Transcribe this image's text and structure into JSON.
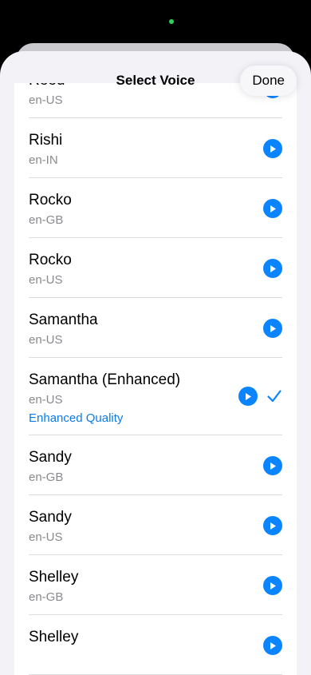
{
  "header": {
    "title": "Select Voice",
    "done_label": "Done"
  },
  "voices": [
    {
      "name": "Reed",
      "locale": "en-US"
    },
    {
      "name": "Rishi",
      "locale": "en-IN"
    },
    {
      "name": "Rocko",
      "locale": "en-GB"
    },
    {
      "name": "Rocko",
      "locale": "en-US"
    },
    {
      "name": "Samantha",
      "locale": "en-US"
    },
    {
      "name": "Samantha (Enhanced)",
      "locale": "en-US",
      "quality": "Enhanced Quality",
      "selected": true
    },
    {
      "name": "Sandy",
      "locale": "en-GB"
    },
    {
      "name": "Sandy",
      "locale": "en-US"
    },
    {
      "name": "Shelley",
      "locale": "en-GB"
    },
    {
      "name": "Shelley",
      "locale": ""
    }
  ],
  "colors": {
    "accent": "#0a84ff",
    "secondary_text": "#8a8a8e",
    "sheet_background": "#f2f2f7"
  },
  "icons": {
    "play": "play-icon",
    "selected": "checkmark-icon"
  }
}
